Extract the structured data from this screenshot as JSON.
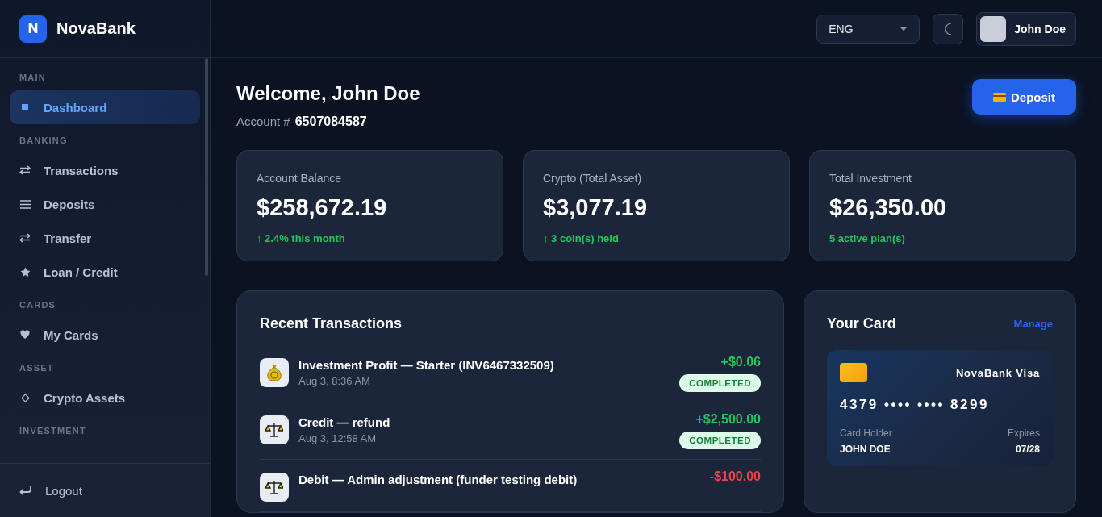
{
  "brand": {
    "logo_letter": "N",
    "name": "NovaBank"
  },
  "sidebar": {
    "sections": [
      {
        "title": "MAIN",
        "items": [
          {
            "kind": "square",
            "label": "Dashboard",
            "selected": true
          }
        ]
      },
      {
        "title": "BANKING",
        "items": [
          {
            "kind": "swap",
            "label": "Transactions",
            "selected": false
          },
          {
            "kind": "list",
            "label": "Deposits",
            "selected": false
          },
          {
            "kind": "swap",
            "label": "Transfer",
            "selected": false
          },
          {
            "kind": "star",
            "label": "Loan / Credit",
            "selected": false
          }
        ]
      },
      {
        "title": "CARDS",
        "items": [
          {
            "kind": "heart",
            "label": "My Cards",
            "selected": false
          }
        ]
      },
      {
        "title": "ASSET",
        "items": [
          {
            "kind": "diamond",
            "label": "Crypto Assets",
            "selected": false
          }
        ]
      },
      {
        "title": "INVESTMENT"
      }
    ],
    "logout": "Logout"
  },
  "topbar": {
    "language": "ENG",
    "user_name": "John Doe"
  },
  "welcome": {
    "title": "Welcome, John Doe",
    "account_label": "Account #",
    "account_number": "6507084587",
    "deposit_button": "Deposit"
  },
  "stats": [
    {
      "label": "Account Balance",
      "value": "$258,672.19",
      "note": "↑ 2.4% this month"
    },
    {
      "label": "Crypto (Total Asset)",
      "value": "$3,077.19",
      "note": "↑ 3 coin(s) held"
    },
    {
      "label": "Total Investment",
      "value": "$26,350.00",
      "note": "5 active plan(s)"
    }
  ],
  "transactions": {
    "title": "Recent Transactions",
    "rows": [
      {
        "kind": "profit",
        "title": "Investment Profit — Starter (INV6467332509)",
        "date": "Aug 3, 8:36 AM",
        "amount": "+$0.06",
        "status": "COMPLETED"
      },
      {
        "kind": "credit",
        "title": "Credit — refund",
        "date": "Aug 3, 12:58 AM",
        "amount": "+$2,500.00",
        "status": "COMPLETED"
      },
      {
        "kind": "debit",
        "title": "Debit — Admin adjustment (funder testing debit)",
        "amount": "-$100.00"
      }
    ]
  },
  "card": {
    "title": "Your Card",
    "manage": "Manage",
    "brand": "NovaBank Visa",
    "number": "4379 •••• •••• 8299",
    "holder_label": "Card Holder",
    "holder": "JOHN DOE",
    "expires_label": "Expires",
    "expires": "07/28"
  }
}
